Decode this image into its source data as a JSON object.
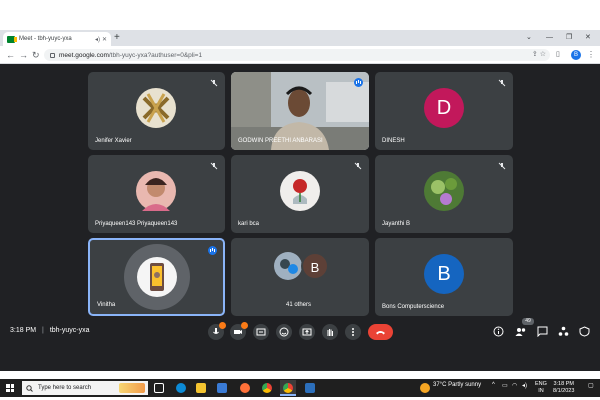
{
  "browser": {
    "tab_title": "Meet - tbh-yuyc-yxa",
    "url_host": "meet.google.com",
    "url_path": "/tbh-yuyc-yxa?authuser=0&pli=1",
    "profile_initial": "B"
  },
  "participants": [
    {
      "name": "Jenifer Xavier",
      "type": "photo",
      "mic_muted": true
    },
    {
      "name": "GODWIN PREETHI ANBARASI",
      "type": "video",
      "speaking": true
    },
    {
      "name": "DINESH",
      "type": "letter",
      "letter": "D",
      "color": "#c2185b",
      "mic_muted": true
    },
    {
      "name": "Priyaqueen143 Priyaqueen143",
      "type": "photo",
      "mic_muted": true
    },
    {
      "name": "kari bca",
      "type": "photo",
      "mic_muted": true
    },
    {
      "name": "Jayanthi B",
      "type": "photo",
      "mic_muted": true
    },
    {
      "name": "Vinitha",
      "type": "photo",
      "speaking": true,
      "active": true
    },
    {
      "name": "41 others",
      "type": "group",
      "letter": "B"
    },
    {
      "name": "Bons Computerscience",
      "type": "letter",
      "letter": "B",
      "color": "#1565c0"
    }
  ],
  "meeting": {
    "time": "3:18 PM",
    "code": "tbh-yuyc-yxa",
    "people_count": "49"
  },
  "taskbar": {
    "search_placeholder": "Type here to search",
    "weather": "37°C  Partly sunny",
    "lang": "ENG",
    "lang_sub": "IN",
    "time": "3:18 PM",
    "date": "8/1/2023"
  }
}
